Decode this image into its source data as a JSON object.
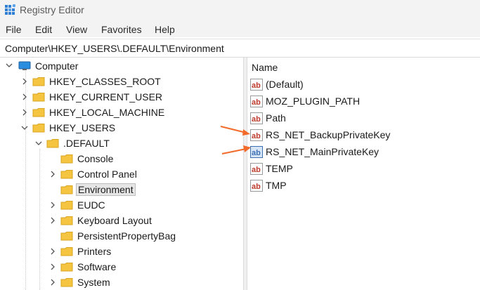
{
  "window": {
    "title": "Registry Editor"
  },
  "menu": [
    "File",
    "Edit",
    "View",
    "Favorites",
    "Help"
  ],
  "address": "Computer\\HKEY_USERS\\.DEFAULT\\Environment",
  "tree": {
    "root": "Computer",
    "hives": [
      "HKEY_CLASSES_ROOT",
      "HKEY_CURRENT_USER",
      "HKEY_LOCAL_MACHINE",
      "HKEY_USERS"
    ],
    "default_key": ".DEFAULT",
    "subkeys": [
      "Console",
      "Control Panel",
      "Environment",
      "EUDC",
      "Keyboard Layout",
      "PersistentPropertyBag",
      "Printers",
      "Software",
      "System"
    ],
    "selected": "Environment"
  },
  "values_pane": {
    "column_name": "Name",
    "values": [
      {
        "name": "(Default)",
        "type_icon": "string-ab-icon"
      },
      {
        "name": "MOZ_PLUGIN_PATH",
        "type_icon": "string-ab-icon"
      },
      {
        "name": "Path",
        "type_icon": "string-ab-icon"
      },
      {
        "name": "RS_NET_BackupPrivateKey",
        "type_icon": "string-ab-icon"
      },
      {
        "name": "RS_NET_MainPrivateKey",
        "type_icon": "binary-icon"
      },
      {
        "name": "TEMP",
        "type_icon": "string-ab-icon"
      },
      {
        "name": "TMP",
        "type_icon": "string-ab-icon"
      }
    ]
  },
  "colors": {
    "annotation_arrow": "#f26b2a",
    "folder": "#f5c440",
    "string_icon_red": "#c0392b",
    "binary_icon_blue": "#3d6fb5"
  }
}
